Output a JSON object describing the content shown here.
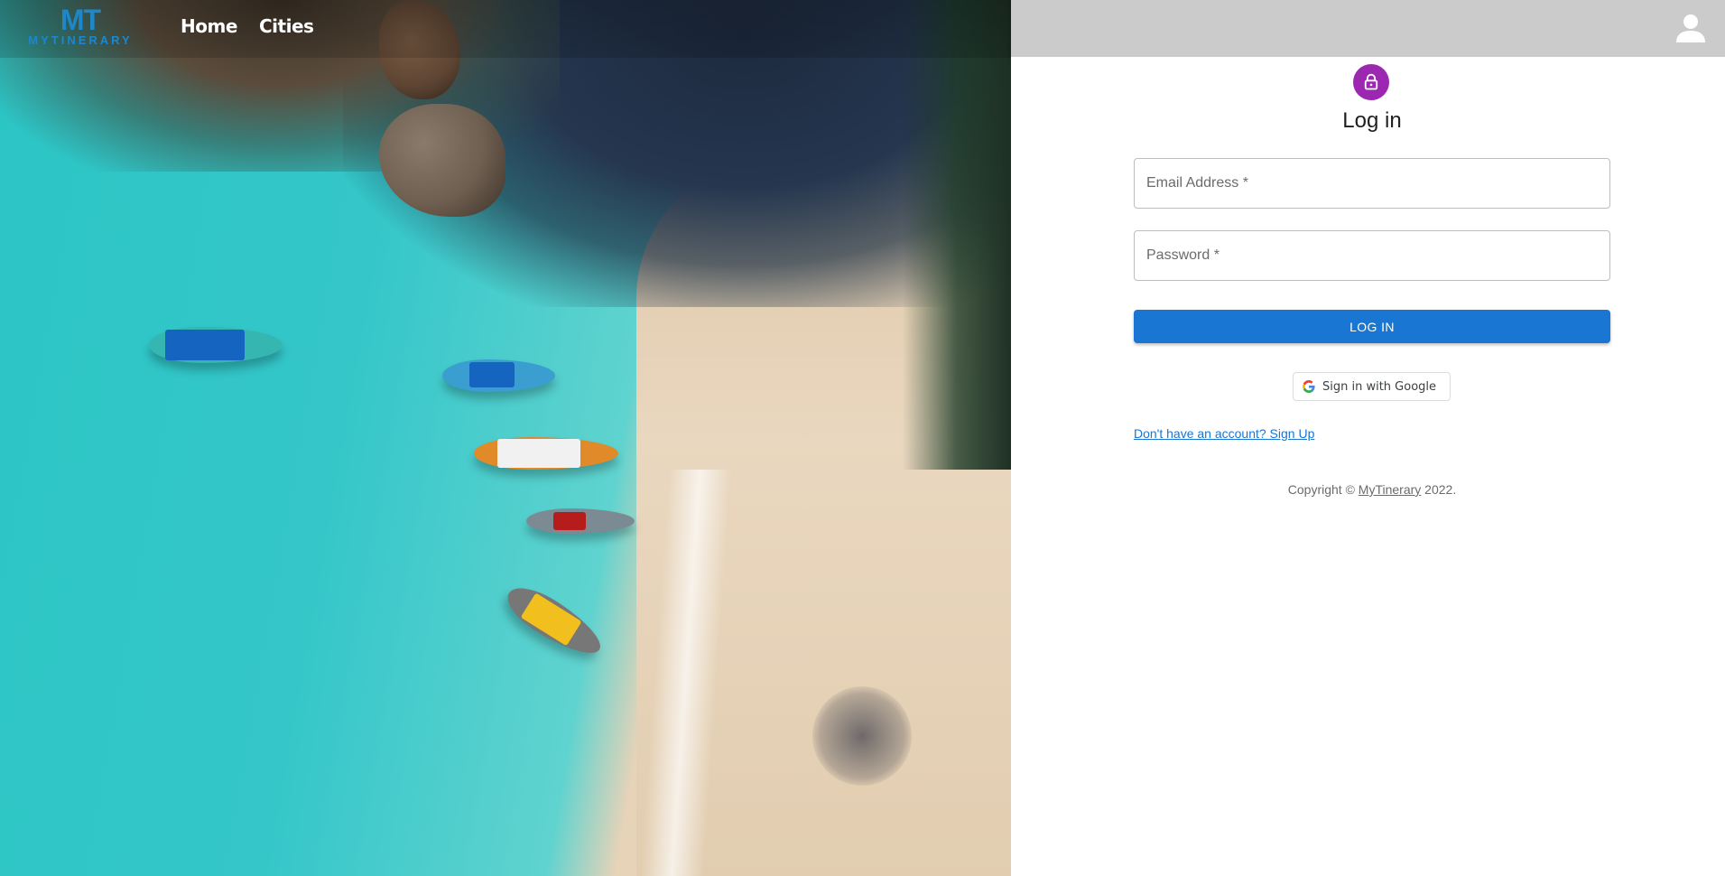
{
  "nav": {
    "brand_mark": "MT",
    "brand_name": "MYTINERARY",
    "links": [
      {
        "label": "Home"
      },
      {
        "label": "Cities"
      }
    ],
    "user_icon": "account-circle-icon"
  },
  "login": {
    "lock_icon": "lock-icon",
    "title": "Log in",
    "email_placeholder": "Email Address *",
    "password_placeholder": "Password *",
    "submit_label": "LOG IN",
    "google_label": "Sign in with Google",
    "signup_link": "Don't have an account? Sign Up",
    "accent_color": "#1976d2",
    "avatar_color": "#9c27b0"
  },
  "footer": {
    "copyright_prefix": "Copyright © ",
    "copyright_link": "MyTinerary",
    "copyright_suffix": " 2022."
  }
}
